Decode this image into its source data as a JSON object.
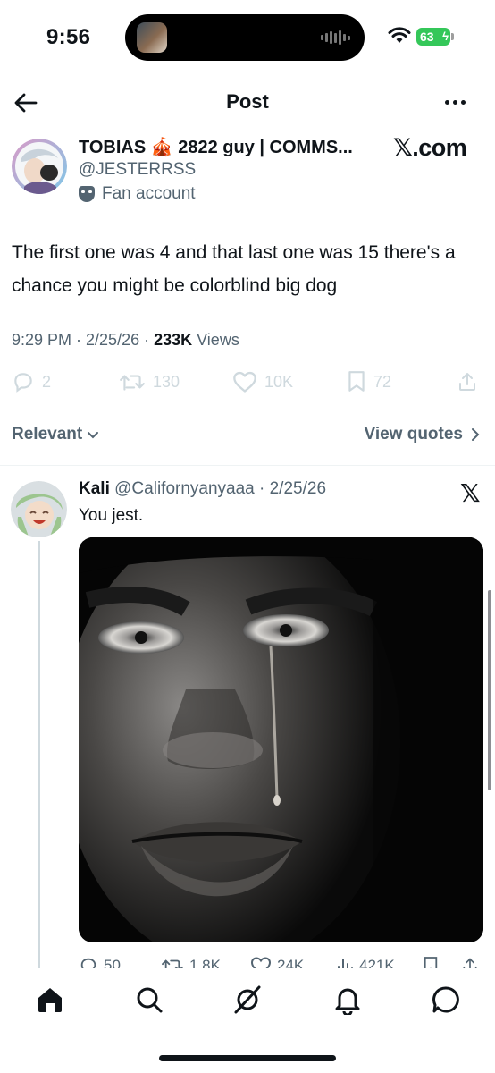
{
  "status_bar": {
    "time": "9:56",
    "battery": "63",
    "battery_color": "#34c759"
  },
  "header": {
    "title": "Post",
    "back_icon": "arrow-left-icon",
    "more_icon": "more-horizontal-icon"
  },
  "post": {
    "author": {
      "display_name": "TOBIAS 🎪 2822 guy | COMMS...",
      "handle": "@JESTERRSS",
      "label": "Fan account",
      "label_icon": "mask-icon"
    },
    "watermark": "𝕏.com",
    "text": "The first one was 4 and that last one was 15 there's a chance you might be colorblind big dog",
    "meta": {
      "time_date": "9:29 PM · 2/25/26 · ",
      "views_count": "233K",
      "views_label": " Views"
    },
    "actions": [
      {
        "icon": "reply-icon",
        "count": "2"
      },
      {
        "icon": "retweet-icon",
        "count": "130"
      },
      {
        "icon": "heart-icon",
        "count": "10K"
      },
      {
        "icon": "bookmark-icon",
        "count": "72"
      },
      {
        "icon": "share-icon",
        "count": ""
      }
    ]
  },
  "replies_bar": {
    "sort_label": "Relevant",
    "quotes_label": "View quotes"
  },
  "reply": {
    "name": "Kali",
    "meta": "@Californyanyaaa · 2/25/26",
    "source_icon": "x-logo-icon",
    "source_glyph": "𝕏",
    "text": "You jest.",
    "actions": [
      {
        "icon": "reply-icon",
        "count": "50"
      },
      {
        "icon": "retweet-icon",
        "count": "1.8K"
      },
      {
        "icon": "heart-icon",
        "count": "24K"
      },
      {
        "icon": "views-icon",
        "count": "421K"
      },
      {
        "icon": "bookmark-icon",
        "count": ""
      },
      {
        "icon": "share-icon",
        "count": ""
      }
    ]
  },
  "tab_bar": {
    "tabs": [
      "home-icon",
      "search-icon",
      "grok-icon",
      "notifications-icon",
      "messages-icon"
    ],
    "active": "home-icon"
  },
  "colors": {
    "text_primary": "#0f1419",
    "text_secondary": "#536471",
    "muted_icon": "#cfd9de"
  }
}
